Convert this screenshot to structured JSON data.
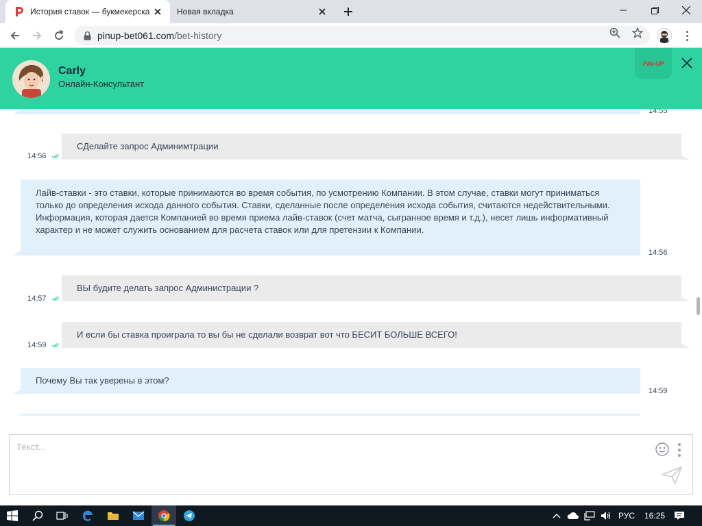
{
  "browser": {
    "tabs": [
      {
        "title": "История ставок — букмекерска",
        "active": true
      },
      {
        "title": "Новая вкладка",
        "active": false
      }
    ],
    "url_host": "pinup-bet061.com",
    "url_path": "/bet-history"
  },
  "chat": {
    "agent_name": "Carly",
    "agent_role": "Онлайн-Консультант",
    "brand": "PIN-UP",
    "messages": [
      {
        "from": "agent",
        "text": "",
        "time": "14:55"
      },
      {
        "from": "user",
        "text": "СДелайте запрос Админимтрации",
        "time": "14:56"
      },
      {
        "from": "agent",
        "text": "Лайв-ставки - это ставки, которые принимаются во время события, по усмотрению Компании. В этом случае, ставки могут приниматься только до определения исхода данного события. Ставки, сделанные после определения исхода события, считаются недействительными. Информация, которая дается Компанией во время приема лайв-ставок (счет матча, сыгранное время и т.д.), несет лишь информативный характер и не может служить основанием для расчета ставок или для претензии к Компании.",
        "time": "14:56"
      },
      {
        "from": "user",
        "text": "ВЫ будите делать запрос Администрации ?",
        "time": "14:57"
      },
      {
        "from": "user",
        "text": "И если бы ставка проиграла то вы бы не сделали возврат вот что БЕСИТ БОЛЬШЕ ВСЕГО!",
        "time": "14:59"
      },
      {
        "from": "agent",
        "text": "Почему Вы так уверены в этом?",
        "time": "14:59"
      }
    ],
    "input_placeholder": "Текст..."
  },
  "taskbar": {
    "language": "РУС",
    "clock": "16:25"
  },
  "colors": {
    "header_green": "#2ed3a0",
    "agent_bubble": "#e1f0fb",
    "user_bubble": "#ebebeb",
    "tick_color": "#2ed3a0"
  }
}
